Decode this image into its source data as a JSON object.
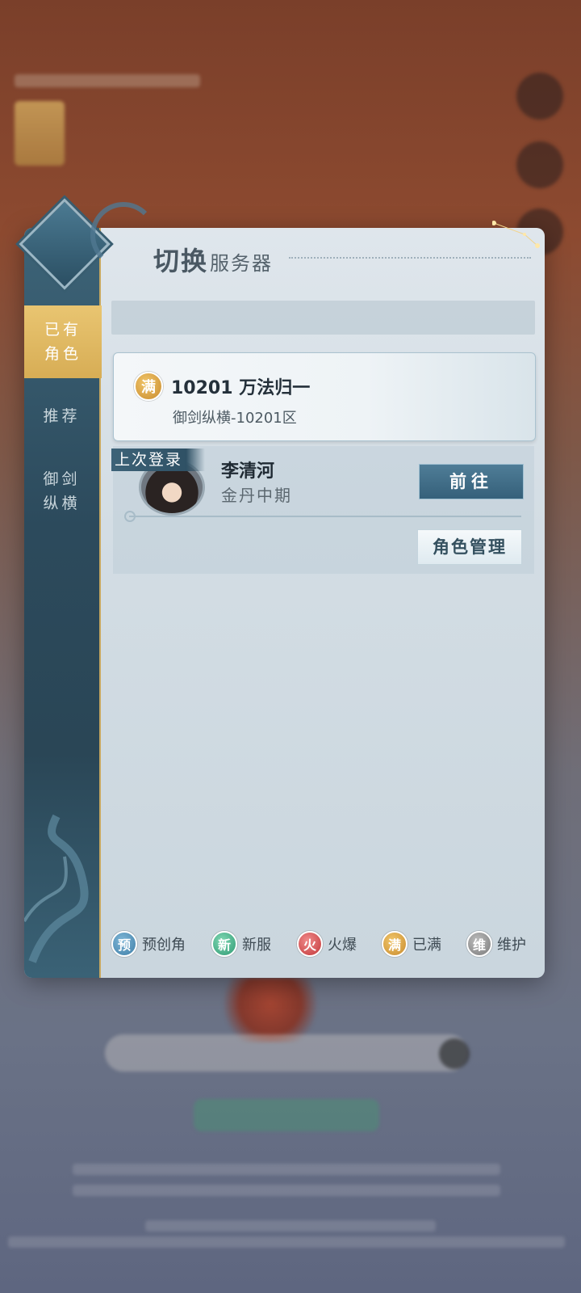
{
  "background": {
    "color": "#7a3f2a"
  },
  "panel": {
    "title_main": "切换",
    "title_sub": "服务器"
  },
  "sidebar": {
    "items": [
      {
        "label_line1": "已有",
        "label_line2": "角色",
        "active": true
      },
      {
        "label_line1": "推荐",
        "label_line2": "",
        "active": false
      },
      {
        "label_line1": "御剑",
        "label_line2": "纵横",
        "active": false
      }
    ],
    "accent": "#d7ad55"
  },
  "server": {
    "badge": "满",
    "name": "10201 万法归一",
    "subtitle": "御剑纵横-10201区"
  },
  "role": {
    "last_login_tag": "上次登录",
    "name": "李清河",
    "realm": "金丹中期",
    "go_button": "前往",
    "manage_button": "角色管理"
  },
  "legend": [
    {
      "badge": "预",
      "label": "预创角",
      "color": "#3f7fa8"
    },
    {
      "badge": "新",
      "label": "新服",
      "color": "#2f9a74"
    },
    {
      "badge": "火",
      "label": "火爆",
      "color": "#c2383a"
    },
    {
      "badge": "满",
      "label": "已满",
      "color": "#c98c2e"
    },
    {
      "badge": "维",
      "label": "维护",
      "color": "#7b7b7b"
    }
  ]
}
